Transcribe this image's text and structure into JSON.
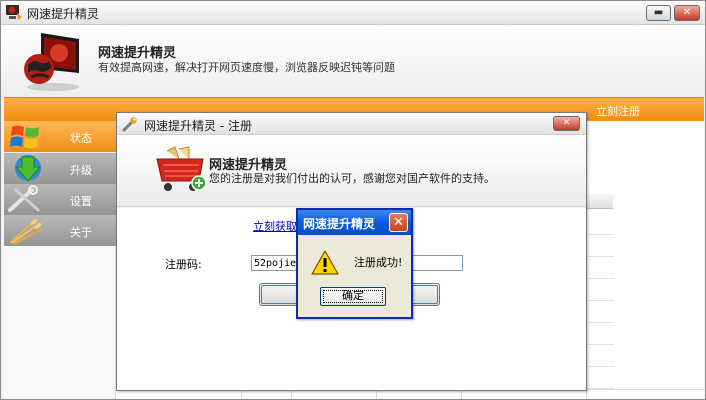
{
  "main_window": {
    "title": "网速提升精灵",
    "minimize_icon": "minimize-icon",
    "close_icon": "close-icon"
  },
  "header": {
    "app_name": "网速提升精灵",
    "description": "有效提高网速，解决打开网页速度慢，浏览器反映迟钝等问题",
    "logo_icon": "globe-monitor-logo"
  },
  "toolbar": {
    "register_link": "立刻注册"
  },
  "sidebar": {
    "items": [
      {
        "label": "状态",
        "icon": "windows-logo-icon",
        "active": true
      },
      {
        "label": "升级",
        "icon": "download-arrow-icon",
        "active": false
      },
      {
        "label": "设置",
        "icon": "tools-icon",
        "active": false
      },
      {
        "label": "关于",
        "icon": "wheat-icon",
        "active": false
      }
    ]
  },
  "register_dialog": {
    "title": "网速提升精灵 - 注册",
    "header_title": "网速提升精灵",
    "header_subtitle": "您的注册是对我们付出的认可，感谢您对国产软件的支持。",
    "get_code_link": "立刻获取",
    "code_label": "注册码:",
    "code_value": "52pojie",
    "submit_label": "注",
    "icon": "shopping-cart-icon"
  },
  "message_box": {
    "title": "网速提升精灵",
    "message": "注册成功!",
    "ok_label": "确定",
    "icon": "warning-icon"
  },
  "colors": {
    "accent_orange": "#f08b10",
    "xp_blue": "#0c5bd8",
    "link_blue": "#0000cc"
  }
}
